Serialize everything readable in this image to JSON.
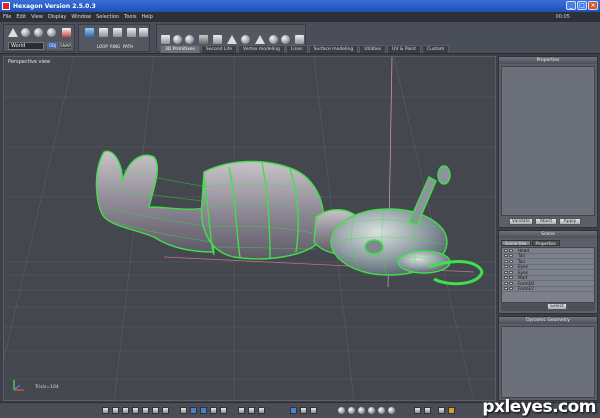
{
  "window": {
    "title": "Hexagon Version 2.5.0.3",
    "controls": [
      "_",
      "□",
      "×"
    ]
  },
  "menu": {
    "items": [
      "File",
      "Edit",
      "View",
      "Display",
      "Window",
      "Selection",
      "Tools",
      "Help"
    ],
    "clock": "00:05"
  },
  "toolbar": {
    "world_select": "World",
    "obj_btn": "OBJ",
    "snap_btn": "SNAP",
    "mode_buttons": [
      "LOOP",
      "RING",
      "PATH"
    ],
    "tabs": [
      "3D Primitives",
      "Second Life",
      "Vertex modeling",
      "Lines",
      "Surface modeling",
      "Utilities",
      "UV & Paint",
      "Custom"
    ],
    "active_tab": 0
  },
  "viewport": {
    "label": "Perspective view",
    "triangles": "Tris/s=104",
    "model_color": "#3fe04a"
  },
  "properties_panel": {
    "title": "Properties",
    "buttons": [
      "Validate",
      "Abort",
      "Apply"
    ]
  },
  "scene_panel": {
    "title": "Scene",
    "tabs": [
      "Scene tree",
      "Properties"
    ],
    "items": [
      "Head",
      "Tail",
      "Tail",
      "Eyes",
      "Eyes",
      "Mart",
      "Form10",
      "Form17"
    ],
    "select_label": "Select"
  },
  "dynamic_panel": {
    "title": "Dynamic Geometry"
  },
  "statusbar": {
    "mode_label": "Pointer"
  },
  "watermark": "pxleyes.com"
}
